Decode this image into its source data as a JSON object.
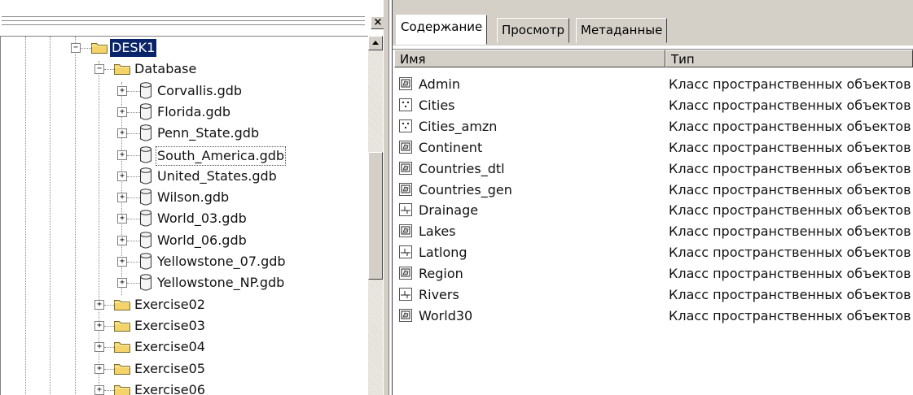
{
  "left_panel": {
    "close_symbol": "×",
    "tree": [
      {
        "label": "DESK1",
        "indent": 0,
        "expander": "−",
        "icon": "folder-icon",
        "selected": true
      },
      {
        "label": "Database",
        "indent": 1,
        "expander": "−",
        "icon": "folder-icon"
      },
      {
        "label": "Corvallis.gdb",
        "indent": 2,
        "expander": "+",
        "icon": "geodatabase-icon"
      },
      {
        "label": "Florida.gdb",
        "indent": 2,
        "expander": "+",
        "icon": "geodatabase-icon"
      },
      {
        "label": "Penn_State.gdb",
        "indent": 2,
        "expander": "+",
        "icon": "geodatabase-icon"
      },
      {
        "label": "South_America.gdb",
        "indent": 2,
        "expander": "+",
        "icon": "geodatabase-icon",
        "focused": true
      },
      {
        "label": "United_States.gdb",
        "indent": 2,
        "expander": "+",
        "icon": "geodatabase-icon"
      },
      {
        "label": "Wilson.gdb",
        "indent": 2,
        "expander": "+",
        "icon": "geodatabase-icon"
      },
      {
        "label": "World_03.gdb",
        "indent": 2,
        "expander": "+",
        "icon": "geodatabase-icon"
      },
      {
        "label": "World_06.gdb",
        "indent": 2,
        "expander": "+",
        "icon": "geodatabase-icon"
      },
      {
        "label": "Yellowstone_07.gdb",
        "indent": 2,
        "expander": "+",
        "icon": "geodatabase-icon"
      },
      {
        "label": "Yellowstone_NP.gdb",
        "indent": 2,
        "expander": "+",
        "icon": "geodatabase-icon"
      },
      {
        "label": "Exercise02",
        "indent": 1,
        "expander": "+",
        "icon": "folder-icon"
      },
      {
        "label": "Exercise03",
        "indent": 1,
        "expander": "+",
        "icon": "folder-icon"
      },
      {
        "label": "Exercise04",
        "indent": 1,
        "expander": "+",
        "icon": "folder-icon"
      },
      {
        "label": "Exercise05",
        "indent": 1,
        "expander": "+",
        "icon": "folder-icon"
      },
      {
        "label": "Exercise06",
        "indent": 1,
        "expander": "+",
        "icon": "folder-icon"
      }
    ]
  },
  "right_panel": {
    "tabs": [
      {
        "label": "Содержание",
        "active": true
      },
      {
        "label": "Просмотр",
        "active": false
      },
      {
        "label": "Метаданные",
        "active": false
      }
    ],
    "columns": {
      "name": "Имя",
      "type": "Тип"
    },
    "rows": [
      {
        "name": "Admin",
        "type": "Класс пространственных объектов",
        "icon": "polygon-feature-class-icon"
      },
      {
        "name": "Cities",
        "type": "Класс пространственных объектов",
        "icon": "point-feature-class-icon"
      },
      {
        "name": "Cities_amzn",
        "type": "Класс пространственных объектов",
        "icon": "point-feature-class-icon"
      },
      {
        "name": "Continent",
        "type": "Класс пространственных объектов",
        "icon": "polygon-feature-class-icon"
      },
      {
        "name": "Countries_dtl",
        "type": "Класс пространственных объектов",
        "icon": "polygon-feature-class-icon"
      },
      {
        "name": "Countries_gen",
        "type": "Класс пространственных объектов",
        "icon": "polygon-feature-class-icon"
      },
      {
        "name": "Drainage",
        "type": "Класс пространственных объектов",
        "icon": "line-feature-class-icon"
      },
      {
        "name": "Lakes",
        "type": "Класс пространственных объектов",
        "icon": "polygon-feature-class-icon"
      },
      {
        "name": "Latlong",
        "type": "Класс пространственных объектов",
        "icon": "line-feature-class-icon"
      },
      {
        "name": "Region",
        "type": "Класс пространственных объектов",
        "icon": "polygon-feature-class-icon"
      },
      {
        "name": "Rivers",
        "type": "Класс пространственных объектов",
        "icon": "line-feature-class-icon"
      },
      {
        "name": "World30",
        "type": "Класс пространственных объектов",
        "icon": "polygon-feature-class-icon"
      }
    ]
  },
  "colors": {
    "selection_bg": "#0a246a",
    "folder_yellow": "#f3d36a",
    "chrome": "#d4d0c8"
  }
}
